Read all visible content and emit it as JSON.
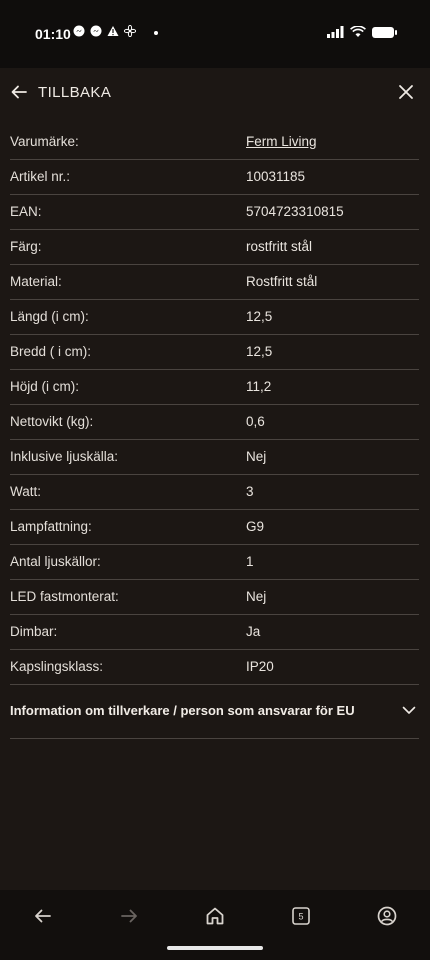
{
  "status": {
    "time": "01:10"
  },
  "header": {
    "back_label": "TILLBAKA",
    "back_icon": "arrow-left-icon",
    "close_icon": "close-icon"
  },
  "specs": [
    {
      "label": "Varumärke:",
      "value": "Ferm Living"
    },
    {
      "label": "Artikel nr.:",
      "value": "10031185"
    },
    {
      "label": "EAN:",
      "value": "5704723310815"
    },
    {
      "label": "Färg:",
      "value": "rostfritt stål"
    },
    {
      "label": "Material:",
      "value": "Rostfritt stål"
    },
    {
      "label": "Längd (i cm):",
      "value": "12,5"
    },
    {
      "label": "Bredd ( i cm):",
      "value": "12,5"
    },
    {
      "label": "Höjd (i cm):",
      "value": "11,2"
    },
    {
      "label": "Nettovikt (kg):",
      "value": "0,6"
    },
    {
      "label": "Inklusive ljuskälla:",
      "value": "Nej"
    },
    {
      "label": "Watt:",
      "value": "3"
    },
    {
      "label": "Lampfattning:",
      "value": "G9"
    },
    {
      "label": "Antal ljuskällor:",
      "value": "1"
    },
    {
      "label": "LED fastmonterat:",
      "value": "Nej"
    },
    {
      "label": "Dimbar:",
      "value": "Ja"
    },
    {
      "label": "Kapslingsklass:",
      "value": "IP20"
    }
  ],
  "accordion": {
    "title": "Information om tillverkare / person som ansvarar för EU"
  },
  "bottom_nav": {
    "tabs_count": "5"
  },
  "colors": {
    "background": "#1c1714",
    "divider": "#4a4440",
    "text": "#e9e4de"
  }
}
